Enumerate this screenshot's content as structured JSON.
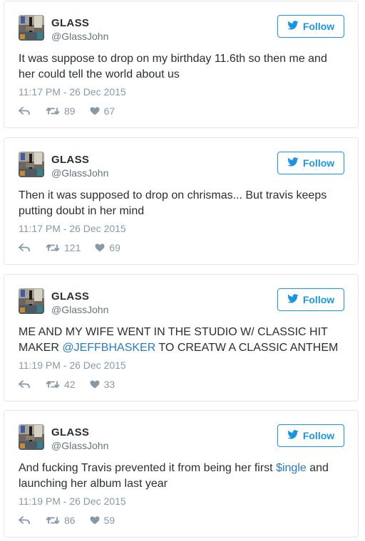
{
  "colors": {
    "accent": "#1b95e0",
    "link": "#2b7bb9",
    "muted": "#8899a6",
    "border": "#e1e8ed"
  },
  "icons": {
    "follow": "twitter-bird-icon",
    "reply": "reply-icon",
    "retweet": "retweet-icon",
    "like": "heart-icon"
  },
  "tweets": [
    {
      "name": "GLASS",
      "handle": "@GlassJohn",
      "follow_label": "Follow",
      "text_before": "It was suppose to drop on my birthday 11.6th so then me and her could tell the world about us",
      "link": "",
      "text_after": "",
      "timestamp": "11:17 PM - 26 Dec 2015",
      "retweets": "89",
      "likes": "67"
    },
    {
      "name": "GLASS",
      "handle": "@GlassJohn",
      "follow_label": "Follow",
      "text_before": "Then it was supposed to drop on chrismas... But travis keeps putting doubt in her mind",
      "link": "",
      "text_after": "",
      "timestamp": "11:17 PM - 26 Dec 2015",
      "retweets": "121",
      "likes": "69"
    },
    {
      "name": "GLASS",
      "handle": "@GlassJohn",
      "follow_label": "Follow",
      "text_before": "ME AND MY WIFE WENT IN THE STUDIO W/ CLASSIC HIT MAKER ",
      "link": "@JEFFBHASKER",
      "text_after": " TO CREATW A CLASSIC ANTHEM",
      "timestamp": "11:19 PM - 26 Dec 2015",
      "retweets": "42",
      "likes": "33"
    },
    {
      "name": "GLASS",
      "handle": "@GlassJohn",
      "follow_label": "Follow",
      "text_before": "And fucking Travis prevented it from being her first ",
      "link": "$ingle",
      "text_after": " and launching her album last year",
      "timestamp": "11:19 PM - 26 Dec 2015",
      "retweets": "86",
      "likes": "59"
    }
  ]
}
